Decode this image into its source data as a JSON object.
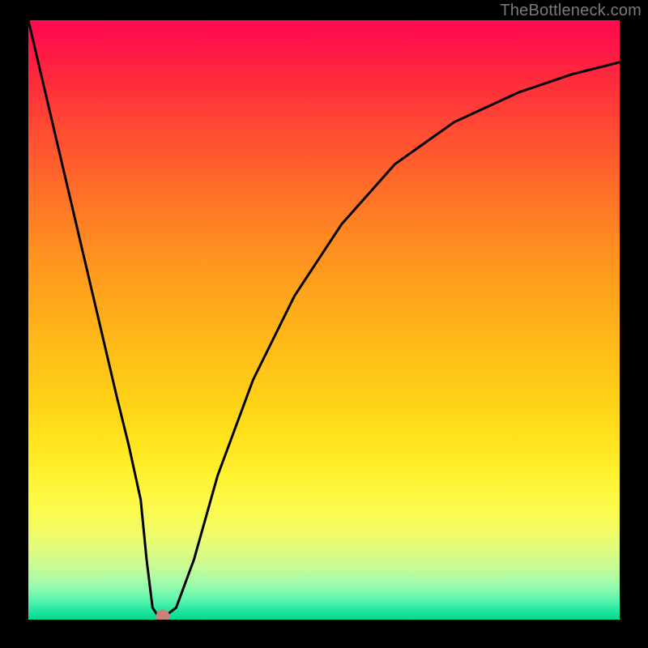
{
  "attribution": "TheBottleneck.com",
  "chart_data": {
    "type": "line",
    "title": "",
    "xlabel": "",
    "ylabel": "",
    "xlim": [
      0,
      100
    ],
    "ylim": [
      0,
      100
    ],
    "grid": false,
    "legend": false,
    "annotations": [],
    "background_gradient": {
      "orientation": "vertical",
      "stops": [
        {
          "pos": 0.0,
          "color": "#ff0a4f"
        },
        {
          "pos": 0.18,
          "color": "#ff4a32"
        },
        {
          "pos": 0.45,
          "color": "#ffa21c"
        },
        {
          "pos": 0.7,
          "color": "#ffe31d"
        },
        {
          "pos": 0.85,
          "color": "#e2fb7c"
        },
        {
          "pos": 1.0,
          "color": "#06d98f"
        }
      ]
    },
    "series": [
      {
        "name": "bottleneck-curve",
        "x": [
          0,
          5,
          10,
          15,
          17,
          19,
          20,
          21,
          22,
          23,
          25,
          28,
          32,
          38,
          45,
          53,
          62,
          72,
          83,
          92,
          100
        ],
        "values": [
          100,
          79,
          58,
          37,
          29,
          20,
          10,
          2,
          0.5,
          0.5,
          2,
          10,
          24,
          40,
          54,
          66,
          76,
          83,
          88,
          91,
          93
        ]
      }
    ],
    "marker": {
      "name": "optimal-point",
      "x": 22.7,
      "y": 0.6,
      "color": "#cd8079"
    }
  },
  "plot_geometry": {
    "outer_w": 800,
    "outer_h": 800,
    "inner_left": 35,
    "inner_top": 25,
    "inner_w": 730,
    "inner_h": 740
  }
}
